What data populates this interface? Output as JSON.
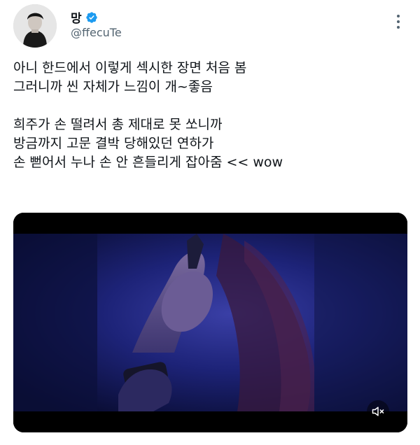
{
  "author": {
    "display_name": "망",
    "handle": "@ffecuTe",
    "verified": true,
    "avatar_icon": "profile-photo"
  },
  "tweet": {
    "lines": [
      "아니 한드에서 이렇게 섹시한 장면 처음 봄",
      "그러니까 씬 자체가 느낌이 개~좋음",
      "",
      "희주가 손 떨려서 총 제대로 못 쏘니까",
      "방금까지 고문 결박 당해있던 연하가",
      "손 뻗어서 누나 손 안 흔들리게 잡아줌 << wow"
    ]
  },
  "media": {
    "type": "video",
    "sound_icon": "speaker-muted-icon"
  },
  "colors": {
    "verified": "#1d9bf0",
    "secondary_text": "#536471",
    "primary_text": "#0f1419"
  }
}
